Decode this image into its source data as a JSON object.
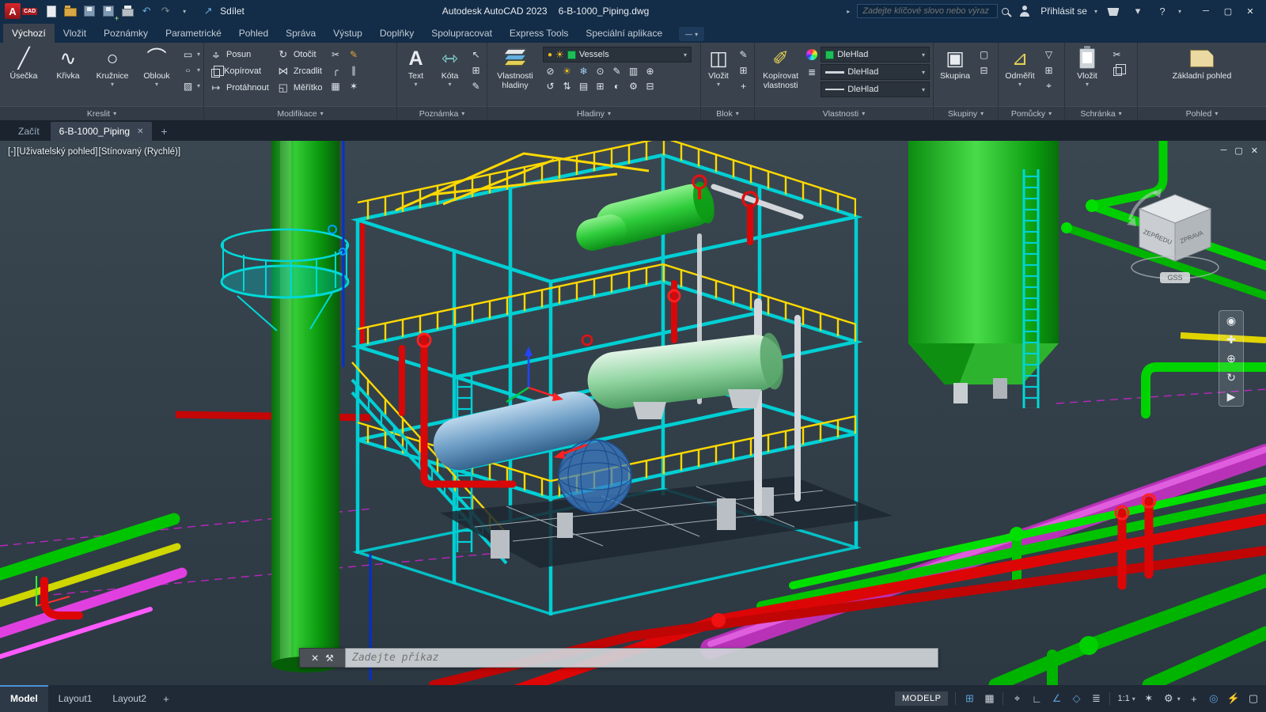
{
  "titlebar": {
    "logo_a": "A",
    "logo_cad": "CAD",
    "app_title": "Autodesk AutoCAD 2023",
    "doc_title": "6-B-1000_Piping.dwg",
    "share": "Sdílet",
    "search_placeholder": "Zadejte klíčové slovo nebo výraz",
    "signin": "Přihlásit se",
    "help": "?",
    "win_min": "─",
    "win_max": "▢",
    "win_close": "✕"
  },
  "ribbon": {
    "tabs": [
      {
        "label": "Výchozí"
      },
      {
        "label": "Vložit"
      },
      {
        "label": "Poznámky"
      },
      {
        "label": "Parametrické"
      },
      {
        "label": "Pohled"
      },
      {
        "label": "Správa"
      },
      {
        "label": "Výstup"
      },
      {
        "label": "Doplňky"
      },
      {
        "label": "Spolupracovat"
      },
      {
        "label": "Express Tools"
      },
      {
        "label": "Speciální aplikace"
      }
    ],
    "kreslit": {
      "title": "Kreslit",
      "t1": "Úsečka",
      "t2": "Křivka",
      "t3": "Kružnice",
      "t4": "Oblouk"
    },
    "modifikace": {
      "title": "Modifikace",
      "r1": "Posun",
      "r2": "Kopírovat",
      "r3": "Protáhnout",
      "r4": "Otočit",
      "r5": "Zrcadlit",
      "r6": "Měřítko"
    },
    "poznamka": {
      "title": "Poznámka",
      "t1": "Text",
      "t2": "Kóta"
    },
    "hladiny": {
      "title": "Hladiny",
      "big": "Vlastnosti hladiny",
      "layer": "Vessels"
    },
    "blok": {
      "title": "Blok",
      "big": "Vložit"
    },
    "vlastnosti": {
      "title": "Vlastnosti",
      "big": "Kopírovat vlastnosti",
      "v1": "DleHlad",
      "v2": "DleHlad",
      "v3": "DleHlad"
    },
    "skupiny": {
      "title": "Skupiny",
      "big": "Skupina"
    },
    "pomucky": {
      "title": "Pomůcky",
      "big": "Odměřit"
    },
    "schranka": {
      "title": "Schránka",
      "big": "Vložit"
    },
    "pohled": {
      "title": "Pohled",
      "big": "Základní pohled"
    }
  },
  "file_tabs": {
    "start": "Začít",
    "doc": "6-B-1000_Piping",
    "close": "✕",
    "add": "+"
  },
  "viewport": {
    "c1": "[-]",
    "c2": "[Uživatelský pohled]",
    "c3": "[Stínovaný (Rychlé)]",
    "win_min": "─",
    "win_max": "▢",
    "win_close": "✕",
    "viewcube": {
      "front": "ZEPŘEDU",
      "right": "ZPRAVA",
      "compass": "GSS"
    },
    "command_placeholder": "Zadejte příkaz"
  },
  "statusbar": {
    "model": "Model",
    "layout1": "Layout1",
    "layout2": "Layout2",
    "add": "+",
    "modelp": "MODELP",
    "scale": "1:1"
  },
  "icons": {
    "caret": "▾",
    "arrow": "▸",
    "dash": "—",
    "und": "↶",
    "red": "↷",
    "share": "↗",
    "line": "╱",
    "polyline": "∿",
    "circle": "○",
    "arc": "⌒",
    "rect": "▭",
    "hatch": "▨",
    "move_h": "↔",
    "move_v": "↕",
    "stretch": "↦",
    "rotate": "↻",
    "mirror": "⋈",
    "scale_i": "◱",
    "trim": "✂",
    "fillet": "╭",
    "array": "▦",
    "offset": "∥",
    "explode": "✶",
    "edit": "✎",
    "text": "A",
    "dim": "⇿",
    "mleader": "↖",
    "table": "⊞",
    "insert": "◫",
    "brush": "✐",
    "group": "▣",
    "ungroup": "▢",
    "groupedit": "⊟",
    "measure": "⊿",
    "funnel": "▽",
    "calc": "⊞",
    "idpt": "⌖",
    "cut": "✂",
    "bulb": "●",
    "sun": "☀",
    "list": "≣",
    "close": "✕",
    "wrench": "⚒",
    "grid": "⊞",
    "snap": "▦",
    "infer": "⌖",
    "ortho": "∟",
    "polar": "∠",
    "osnap": "◇",
    "lwt": "≣",
    "annot": "✶",
    "gear": "⚙",
    "plus": "+",
    "isolate": "◎",
    "perf": "⚡",
    "clean": "▢",
    "wheel": "◉",
    "pan": "✚",
    "zoomp": "⊕",
    "orbit": "↻",
    "play": "▶"
  },
  "layer_tools": {
    "r1": [
      "⊘",
      "☀",
      "❄",
      "⊙",
      "✎",
      "▥",
      "⊕"
    ],
    "r2": [
      "↺",
      "⇅",
      "▤",
      "⊞",
      "◐",
      "⚙",
      "⊟"
    ]
  }
}
